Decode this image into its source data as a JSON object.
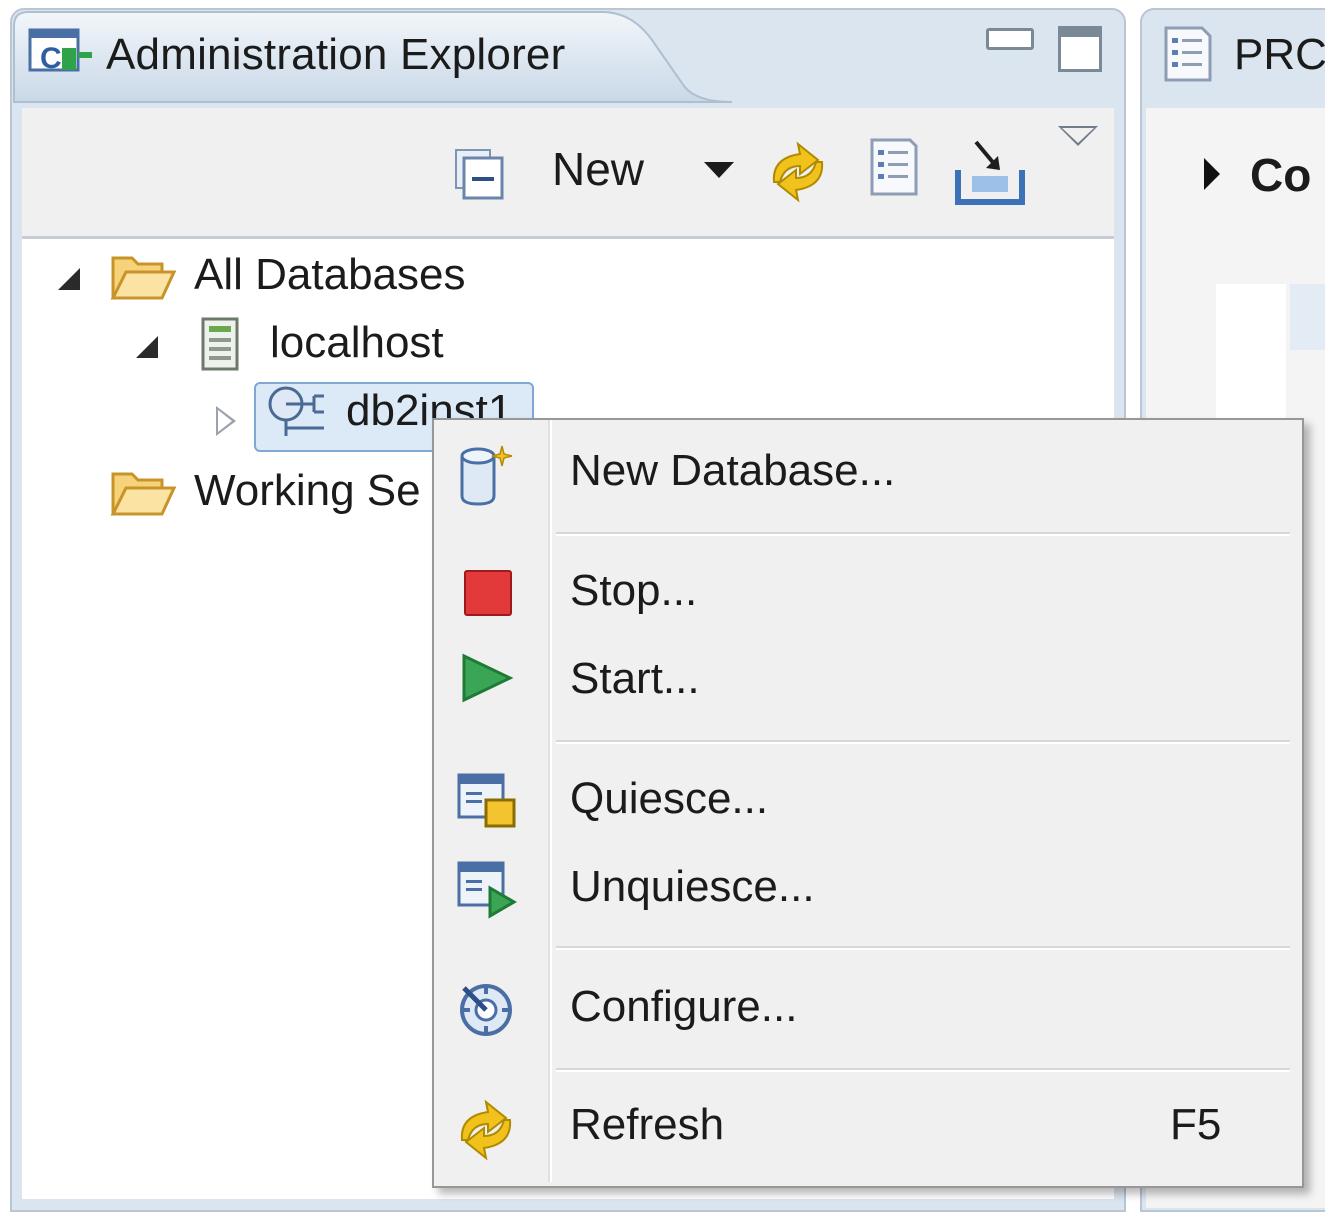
{
  "view": {
    "title": "Administration Explorer"
  },
  "toolbar": {
    "new_label": "New"
  },
  "tree": {
    "items": [
      {
        "label": "All Databases"
      },
      {
        "label": "localhost"
      },
      {
        "label": "db2inst1"
      },
      {
        "label": "Working Se"
      }
    ]
  },
  "right_view": {
    "tab_title": "PRC",
    "section_label": "Co"
  },
  "context_menu": {
    "items": [
      {
        "label": "New Database..."
      },
      {
        "label": "Stop..."
      },
      {
        "label": "Start..."
      },
      {
        "label": "Quiesce..."
      },
      {
        "label": "Unquiesce..."
      },
      {
        "label": "Configure..."
      },
      {
        "label": "Refresh",
        "shortcut": "F5"
      }
    ]
  },
  "colors": {
    "tab_background": "#dbe5ef",
    "toolbar_background": "#f0f0f0",
    "selection_background": "#dceaf8",
    "menu_background": "#f0f0f0",
    "stop_red": "#e23a3a",
    "start_green": "#3aa655"
  }
}
